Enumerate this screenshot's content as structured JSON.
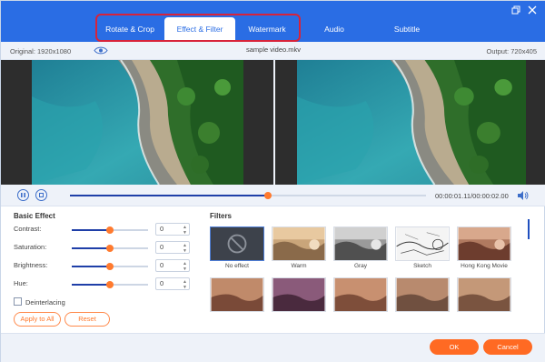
{
  "tabs": [
    {
      "label": "Rotate & Crop"
    },
    {
      "label": "Effect & Filter"
    },
    {
      "label": "Watermark"
    },
    {
      "label": "Audio"
    },
    {
      "label": "Subtitle"
    }
  ],
  "active_tab": "Effect & Filter",
  "highlight_color": "#d8233a",
  "accent_color": "#2a6de4",
  "orange_color": "#ff6a23",
  "info": {
    "original": "Original: 1920x1080",
    "file_name": "sample video.mkv",
    "output": "Output: 720x405"
  },
  "playback": {
    "time": "00:00:01.11/00:00:02.00",
    "progress": 0.555
  },
  "basic_effect": {
    "title": "Basic Effect",
    "controls": [
      {
        "label": "Contrast:",
        "value": "0",
        "level": 0.5
      },
      {
        "label": "Saturation:",
        "value": "0",
        "level": 0.5
      },
      {
        "label": "Brightness:",
        "value": "0",
        "level": 0.5
      },
      {
        "label": "Hue:",
        "value": "0",
        "level": 0.5
      }
    ],
    "deinterlacing_label": "Deinterlacing",
    "deinterlacing_checked": false,
    "apply_all_label": "Apply to All",
    "reset_label": "Reset"
  },
  "filters": {
    "title": "Filters",
    "items": [
      {
        "label": "No effect"
      },
      {
        "label": "Warm"
      },
      {
        "label": "Gray"
      },
      {
        "label": "Sketch"
      },
      {
        "label": "Hong Kong Movie"
      }
    ]
  },
  "footer": {
    "ok_label": "OK",
    "cancel_label": "Cancel"
  },
  "icons": {
    "window_restore": "restore-icon",
    "window_close": "close-icon",
    "preview_toggle": "eye-icon",
    "pause": "pause-icon",
    "stop": "stop-icon",
    "volume": "volume-icon"
  }
}
